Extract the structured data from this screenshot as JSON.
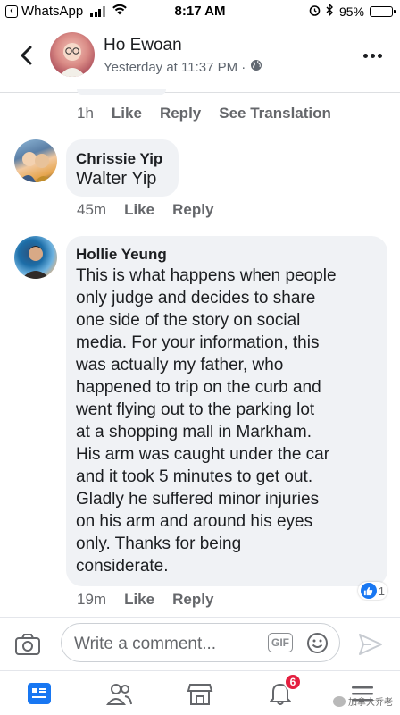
{
  "status_bar": {
    "back_app": "WhatsApp",
    "time": "8:17 AM",
    "battery": "95%",
    "battery_level": 0.95
  },
  "header": {
    "name": "Ho Ewoan",
    "subtitle": "Yesterday at 11:37 PM ·"
  },
  "previous_comment_actions": {
    "time": "1h",
    "like": "Like",
    "reply": "Reply",
    "translation": "See Translation"
  },
  "comments": [
    {
      "author": "Chrissie Yip",
      "text": "Walter Yip",
      "time": "45m",
      "like": "Like",
      "reply": "Reply"
    },
    {
      "author": "Hollie Yeung",
      "lines": [
        "This is what happens when people",
        "only judge and decides to share",
        "one side of the story on social",
        "media. For your information, this",
        "was actually my father, who",
        "happened to trip on the curb and",
        "went flying out to the parking lot",
        "at a shopping mall in Markham.",
        "His arm was caught under the car",
        "and it took 5 minutes to get out.",
        "Gladly he suffered minor injuries",
        "on his arm and around his eyes",
        "only. Thanks for being",
        "considerate."
      ],
      "time": "19m",
      "like": "Like",
      "reply": "Reply",
      "reaction_count": "1"
    }
  ],
  "composer": {
    "placeholder": "Write a comment...",
    "gif": "GIF"
  },
  "tab_bar": {
    "notifications_badge": "6",
    "watermark": "加拿大乔老"
  },
  "colors": {
    "accent": "#1877f2",
    "badge": "#e41e3f",
    "bubble": "#f0f2f5",
    "muted_text": "#65676b"
  },
  "icons": [
    "back-chevron-icon",
    "globe-icon",
    "more-icon",
    "camera-icon",
    "gif-icon",
    "emoji-icon",
    "send-icon",
    "feed-icon",
    "friends-icon",
    "marketplace-icon",
    "bell-icon",
    "menu-icon",
    "like-icon"
  ]
}
